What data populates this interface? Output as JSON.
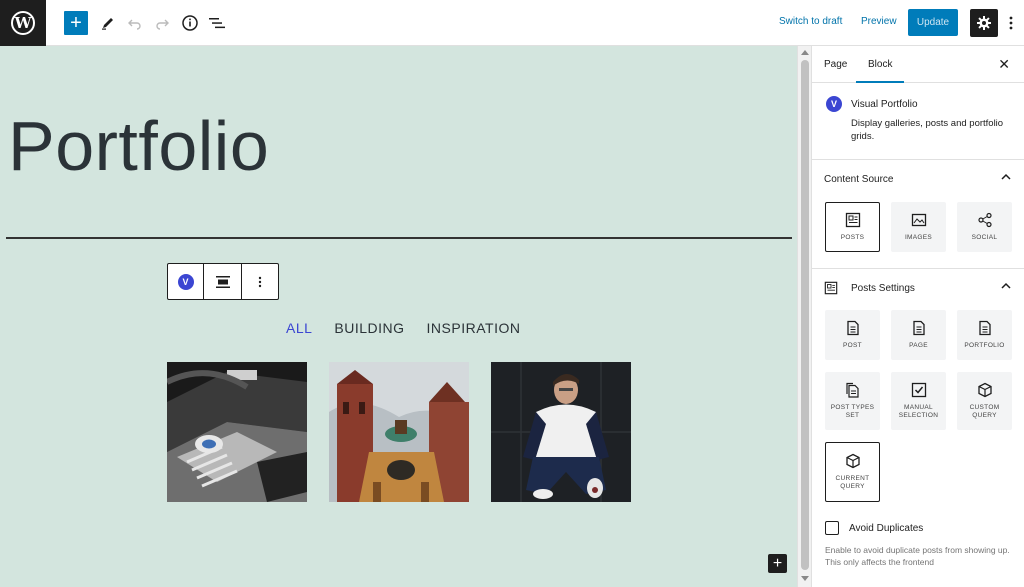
{
  "topbar": {
    "logo_letter": "W",
    "add_label": "+",
    "switch_to_draft": "Switch to draft",
    "preview": "Preview",
    "update": "Update"
  },
  "canvas": {
    "page_title": "Portfolio",
    "block_badge": "V",
    "filters": [
      "ALL",
      "BUILDING",
      "INSPIRATION"
    ],
    "active_filter": "ALL",
    "add_block": "+"
  },
  "sidebar": {
    "tabs": [
      "Page",
      "Block"
    ],
    "active_tab": "Block",
    "close": "✕",
    "block": {
      "badge": "V",
      "title": "Visual Portfolio",
      "description": "Display galleries, posts and portfolio grids."
    },
    "content_source": {
      "title": "Content Source",
      "options": [
        "POSTS",
        "IMAGES",
        "SOCIAL"
      ],
      "selected": "POSTS"
    },
    "posts_settings": {
      "title": "Posts Settings",
      "options": [
        "POST",
        "PAGE",
        "PORTFOLIO",
        "POST TYPES SET",
        "MANUAL SELECTION",
        "CUSTOM QUERY",
        "CURRENT QUERY"
      ],
      "selected": "CURRENT QUERY"
    },
    "avoid_duplicates": {
      "label": "Avoid Duplicates",
      "checked": false,
      "help": "Enable to avoid duplicate posts from showing up. This only affects the frontend"
    }
  },
  "colors": {
    "accent": "#007cba",
    "brand_badge": "#3b46d2",
    "canvas_bg": "#d3e5de"
  }
}
